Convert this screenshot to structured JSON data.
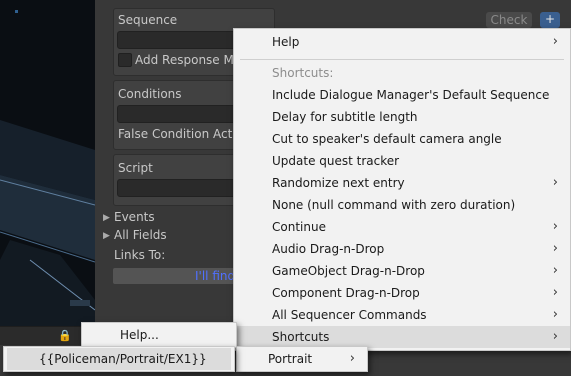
{
  "inspector": {
    "sequence_label": "Sequence",
    "check_label": "Check",
    "plus_label": "+",
    "add_response_label": "Add Response Me",
    "conditions_label": "Conditions",
    "false_condition_label": "False Condition Actio",
    "script_label": "Script",
    "events_label": "Events",
    "all_fields_label": "All Fields",
    "links_to_label": "Links To:",
    "link_button_label": "I'll find"
  },
  "main_menu": {
    "items": [
      {
        "label": "Help",
        "has_submenu": true,
        "disabled": false
      },
      {
        "label": "Shortcuts:",
        "has_submenu": false,
        "disabled": true
      },
      {
        "label": "Include Dialogue Manager's Default Sequence",
        "has_submenu": false,
        "disabled": false
      },
      {
        "label": "Delay for subtitle length",
        "has_submenu": false,
        "disabled": false
      },
      {
        "label": "Cut to speaker's default camera angle",
        "has_submenu": false,
        "disabled": false
      },
      {
        "label": "Update quest tracker",
        "has_submenu": false,
        "disabled": false
      },
      {
        "label": "Randomize next entry",
        "has_submenu": true,
        "disabled": false
      },
      {
        "label": "None (null command with zero duration)",
        "has_submenu": false,
        "disabled": false
      },
      {
        "label": "Continue",
        "has_submenu": true,
        "disabled": false
      },
      {
        "label": "Audio Drag-n-Drop",
        "has_submenu": true,
        "disabled": false
      },
      {
        "label": "GameObject Drag-n-Drop",
        "has_submenu": true,
        "disabled": false
      },
      {
        "label": "Component Drag-n-Drop",
        "has_submenu": true,
        "disabled": false
      },
      {
        "label": "All Sequencer Commands",
        "has_submenu": true,
        "disabled": false
      },
      {
        "label": "Shortcuts",
        "has_submenu": true,
        "disabled": false,
        "highlighted": true
      }
    ]
  },
  "help_menu": {
    "item_label": "Help..."
  },
  "shortcuts_submenu": {
    "portrait_label": "Portrait"
  },
  "portrait_submenu": {
    "item_label": "{{Policeman/Portrait/EX1}}"
  },
  "icons": {
    "submenu_arrow": "›",
    "lock_icon": "🔒",
    "kebab_icon": "⋮",
    "fold_icon": "▶"
  }
}
